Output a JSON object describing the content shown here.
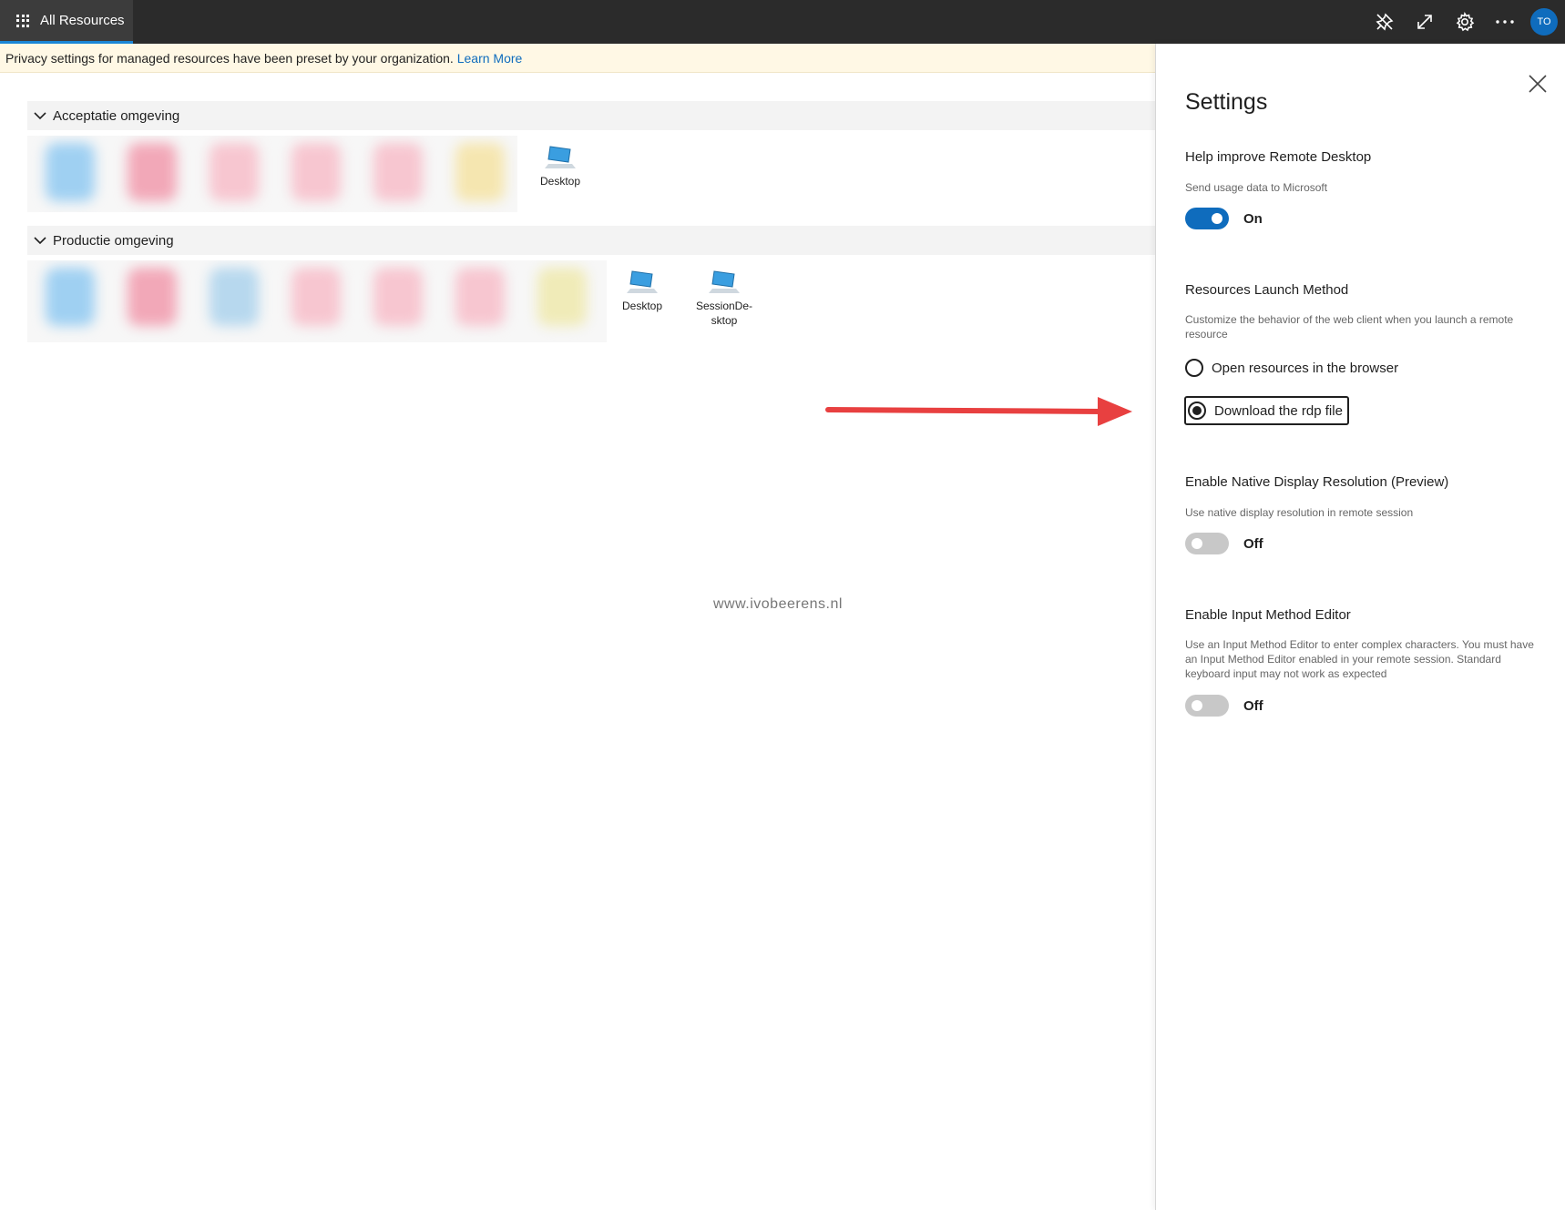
{
  "topbar": {
    "tab_label": "All Resources",
    "avatar_initials": "TO",
    "icons": [
      "pin-off-icon",
      "expand-icon",
      "gear-icon",
      "more-icon"
    ]
  },
  "banner": {
    "text": "Privacy settings for managed resources have been preset by your organization.",
    "link": "Learn More"
  },
  "groups": [
    {
      "name": "Acceptatie omgeving",
      "resources": [
        {
          "label": "Desktop",
          "icon": "desktop-icon"
        }
      ]
    },
    {
      "name": "Productie omgeving",
      "resources": [
        {
          "label": "Desktop",
          "icon": "desktop-icon"
        },
        {
          "label_line1": "SessionDe-",
          "label_line2": "sktop",
          "icon": "desktop-icon"
        }
      ]
    }
  ],
  "watermark": "www.ivobeerens.nl",
  "settings": {
    "title": "Settings",
    "help_improve": {
      "title": "Help improve Remote Desktop",
      "description": "Send usage data to Microsoft",
      "state_label": "On",
      "enabled": true
    },
    "launch_method": {
      "title": "Resources Launch Method",
      "description": "Customize the behavior of the web client when you launch a remote resource",
      "options": [
        "Open resources in the browser",
        "Download the rdp file"
      ],
      "selected": "Download the rdp file"
    },
    "native_resolution": {
      "title": "Enable Native Display Resolution (Preview)",
      "description": "Use native display resolution in remote session",
      "state_label": "Off",
      "enabled": false
    },
    "ime": {
      "title": "Enable Input Method Editor",
      "description": "Use an Input Method Editor to enter complex characters. You must have an Input Method Editor enabled in your remote session. Standard keyboard input may not work as expected",
      "state_label": "Off",
      "enabled": false
    }
  },
  "colors": {
    "accent": "#0f6cbd",
    "topbar": "#2b2b2b",
    "banner": "#fff8e5",
    "annotation": "#e84040"
  }
}
